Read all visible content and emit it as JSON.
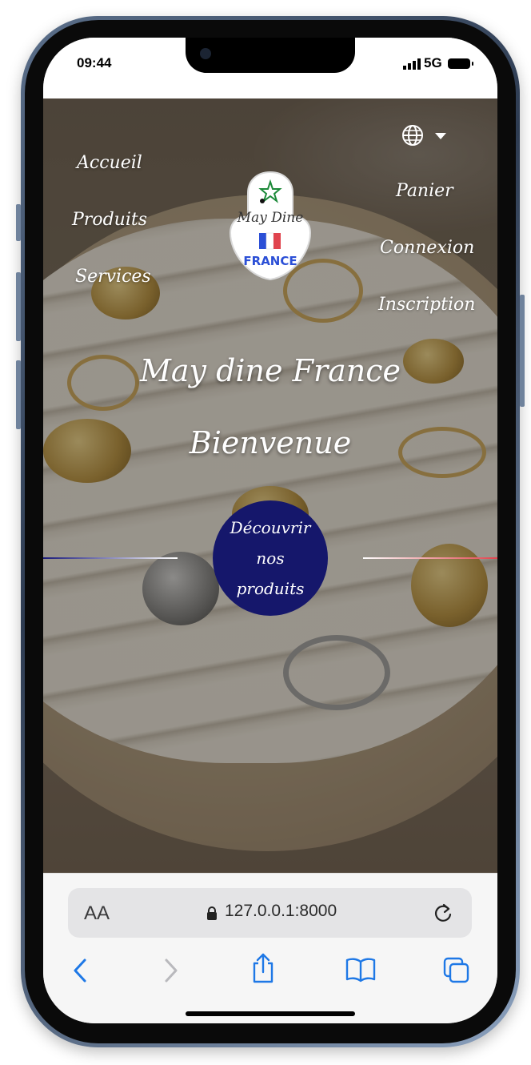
{
  "status_bar": {
    "time": "09:44",
    "network": "5G"
  },
  "site": {
    "nav_left": [
      "Accueil",
      "Produits",
      "Services"
    ],
    "nav_right": [
      "Panier",
      "Connexion",
      "Inscription"
    ],
    "logo": {
      "line1": "May Dine",
      "line2": "FRANCE"
    },
    "title": "May dine France",
    "subtitle": "Bienvenue",
    "cta_label": "Découvrir nos produits",
    "language_icon": "globe-icon"
  },
  "browser": {
    "text_size_label": "AA",
    "url": "127.0.0.1:8000",
    "icons": [
      "lock-icon",
      "reload-icon",
      "back-icon",
      "forward-icon",
      "share-icon",
      "bookmarks-icon",
      "tabs-icon"
    ]
  },
  "colors": {
    "cta": "#15176b",
    "link_blue": "#1e78e6",
    "flag_blue": "#2b4fd6",
    "flag_red": "#e0444e"
  }
}
